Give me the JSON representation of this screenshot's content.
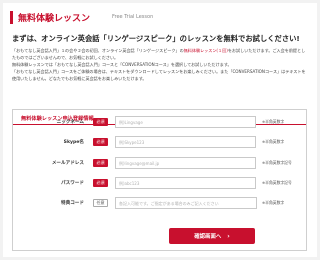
{
  "header": {
    "title": "無料体験レッスン",
    "subtitle": "Free Trial Lesson"
  },
  "headline": "まずは、オンライン英会話「リンゲージスピーク」のレッスンを無料でお試しください!",
  "intro": {
    "line1": "「おもてなし英会話入門」１の会や２会の初回、オンライン英会話「リンゲージスピーク」の",
    "line1_highlight": "無料体験レッスン(１回)",
    "line1_end": "をお試しいただけます。ご入会を前提としたものではございませんので、お気軽にお試しください。",
    "line2": "無料体験レッスンでは「おもてなし英会話入門」コースと「CONVERSATIONコース」を選択してお試しいただけます。",
    "line3": "「おもてなし英会話入門」コースをご体験の場合は、テキストをダウンロードしてレッスンをお楽しみください。また「CONVERSATIONコース」はテキストを使用いたしません。どなたでもお気軽に英会話をお楽しみいただけます。"
  },
  "form": {
    "heading": "無料体験レッスン申込登録情報",
    "fields": [
      {
        "label": "ニックネーム",
        "badge": "必須",
        "placeholder": "例)Lingvage",
        "note": "※半角英数字"
      },
      {
        "label": "Skype名",
        "badge": "必須",
        "placeholder": "例)Skype123",
        "note": "※半角英数字"
      },
      {
        "label": "メールアドレス",
        "badge": "必須",
        "placeholder": "例)lingvage@mail.jp",
        "note": "※半角英数字記号"
      },
      {
        "label": "パスワード",
        "badge": "必須",
        "placeholder": "例)abc123",
        "note": "※半角英数字記号"
      },
      {
        "label": "特典コード",
        "badge": "任意",
        "placeholder": "各記入可能です。ご指定がある場合のみご記入ください",
        "note": "※半角英数字"
      }
    ]
  },
  "submit": {
    "label": "確認画面へ",
    "icon": "arrow-right-icon",
    "arrow_glyph": "›"
  },
  "colors": {
    "brand": "#c8102e",
    "border": "#cfcfcf"
  }
}
